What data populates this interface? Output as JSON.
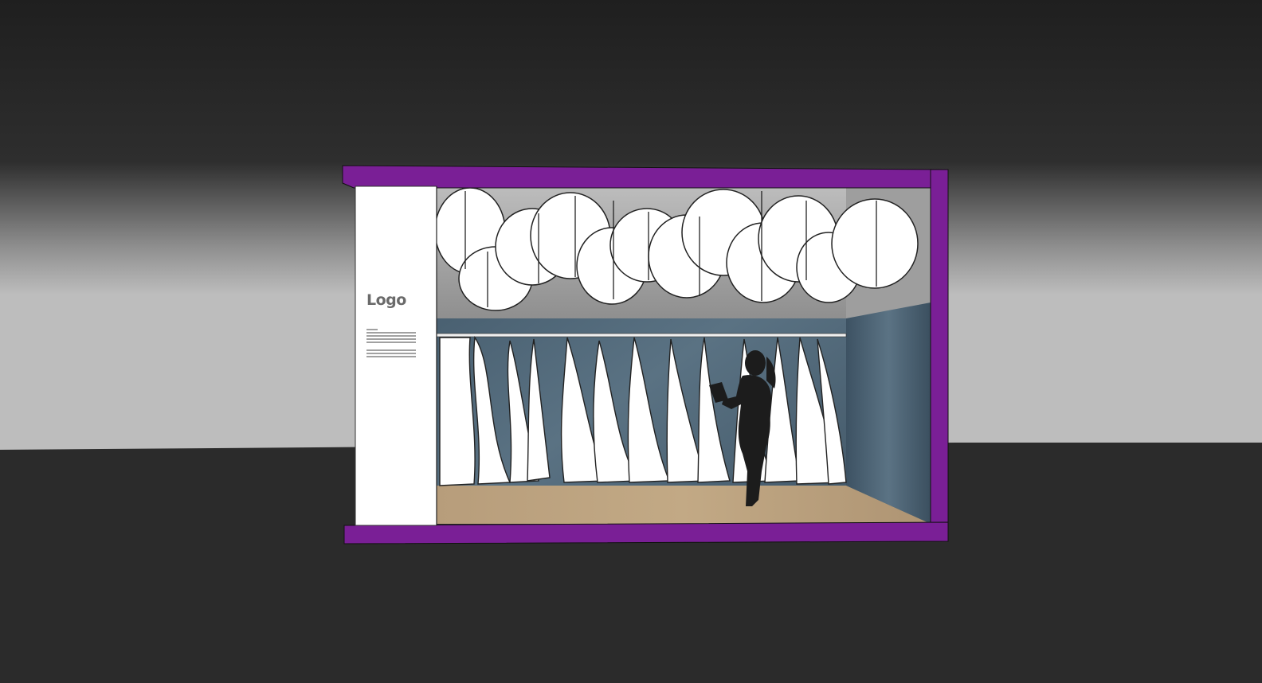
{
  "sign": {
    "logo_text": "Logo"
  },
  "colors": {
    "background_top": "#1f1f1f",
    "background_horizon": "#b9b9b9",
    "floor_ground": "#2b2b2b",
    "booth_frame": "#7a1f96",
    "wall_panel": "#ffffff",
    "back_wall": "#4c6273",
    "ceiling": "#a8a8a8",
    "floor": "#b9a07e",
    "figure": "#1c1c1c"
  }
}
